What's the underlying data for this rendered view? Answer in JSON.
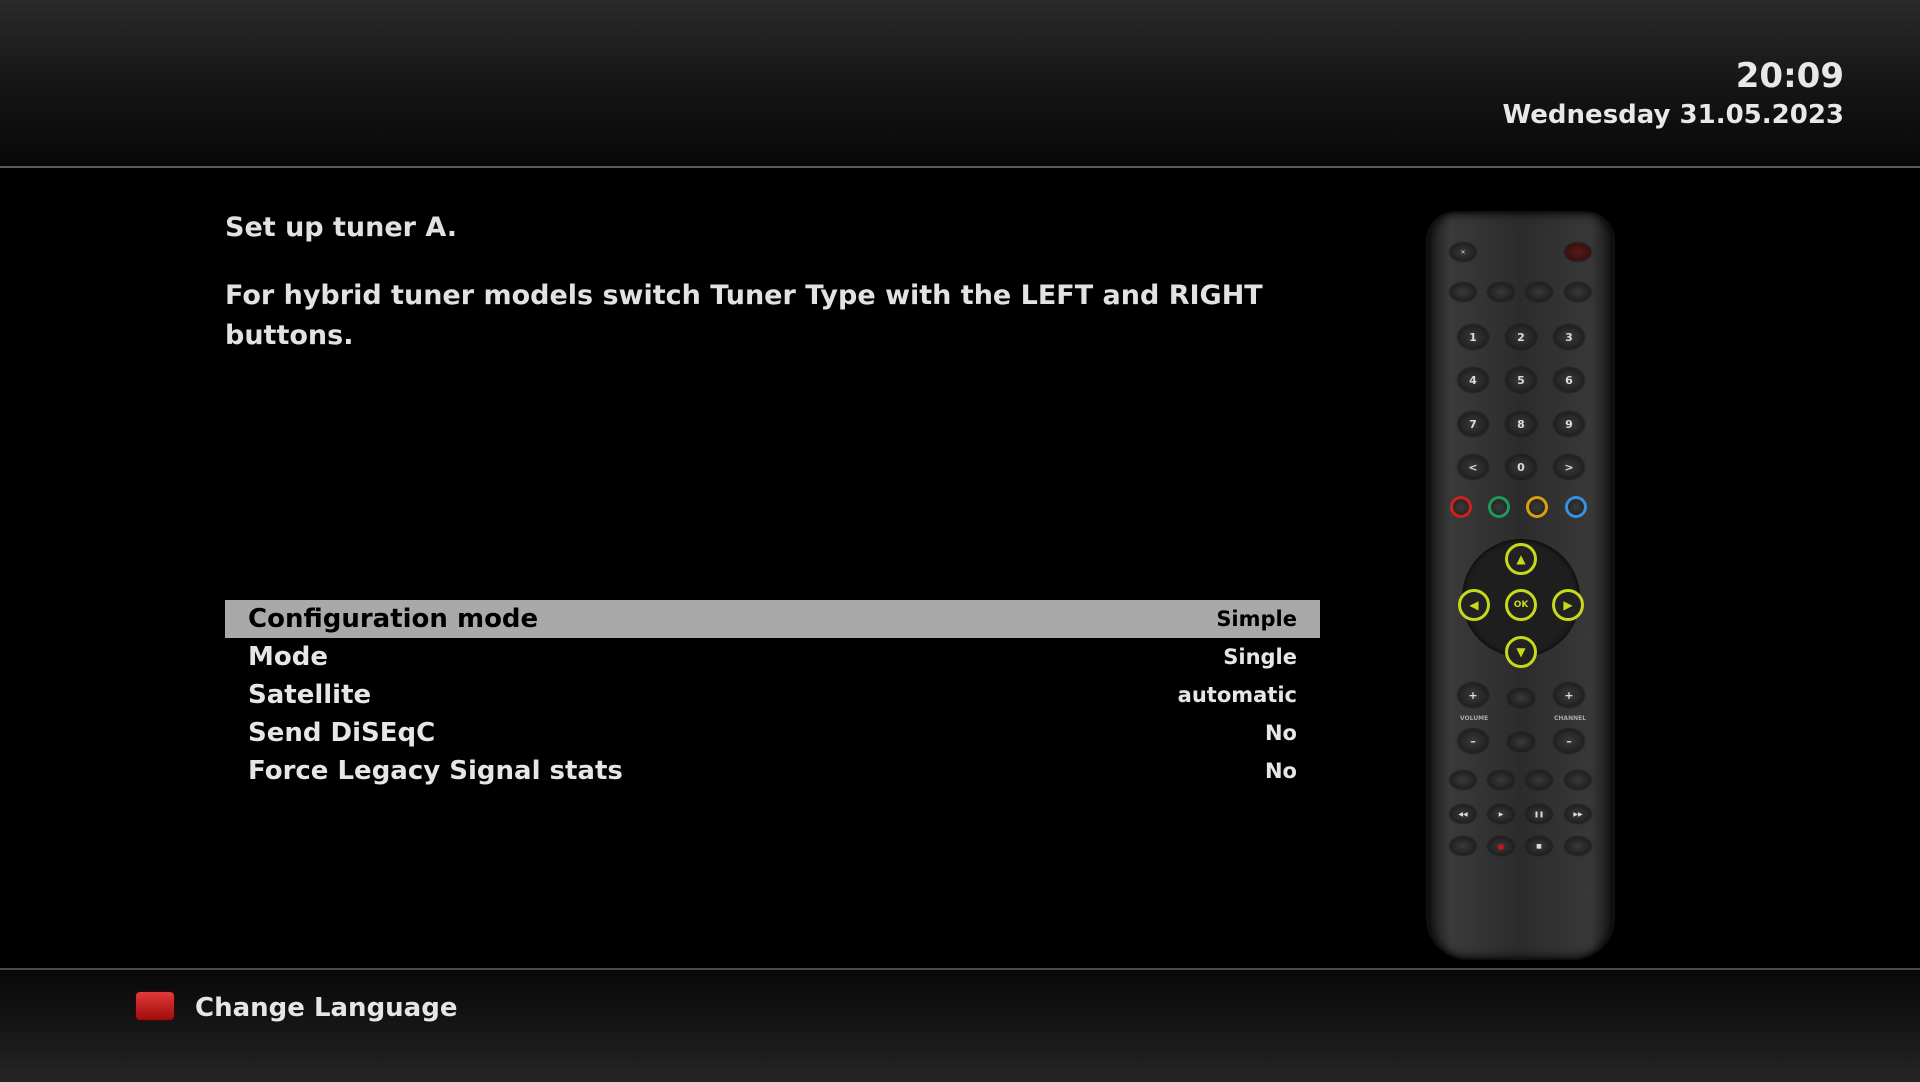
{
  "header": {
    "time": "20:09",
    "date": "Wednesday 31.05.2023"
  },
  "description": {
    "line1": "Set up tuner A.",
    "line2": "For hybrid tuner models switch Tuner Type with the LEFT and RIGHT buttons."
  },
  "menu": {
    "items": [
      {
        "label": "Configuration mode",
        "value": "Simple"
      },
      {
        "label": "Mode",
        "value": "Single"
      },
      {
        "label": "Satellite",
        "value": "automatic"
      },
      {
        "label": "Send DiSEqC",
        "value": "No"
      },
      {
        "label": "Force Legacy Signal stats",
        "value": "No"
      }
    ]
  },
  "footer": {
    "red_label": "Change Language"
  },
  "remote": {
    "digits": [
      "1",
      "2",
      "3",
      "4",
      "5",
      "6",
      "7",
      "8",
      "9",
      "<",
      "0",
      ">"
    ],
    "ok": "OK",
    "volume_label": "VOLUME",
    "channel_label": "CHANNEL",
    "plus": "+",
    "minus": "–"
  },
  "colors": {
    "selection": "#a9a9a9",
    "red_key": "#c61d1d",
    "dpad_highlight": "#c8d81a"
  }
}
